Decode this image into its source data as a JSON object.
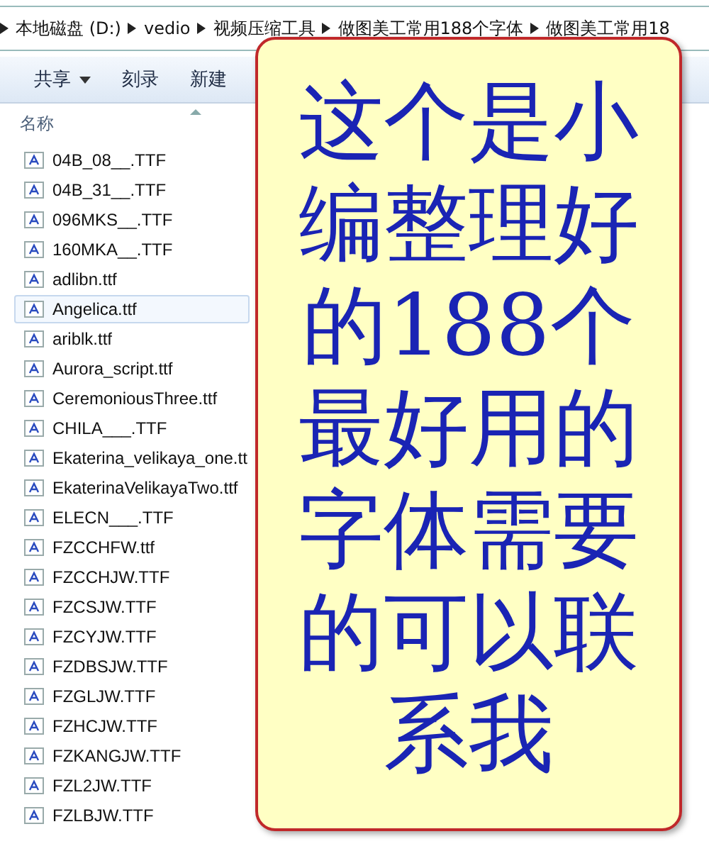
{
  "address_bar": {
    "crumbs": [
      "本地磁盘 (D:)",
      "vedio",
      "视频压缩工具",
      "做图美工常用188个字体",
      "做图美工常用18"
    ]
  },
  "toolbar": {
    "buttons": [
      {
        "label": "共享",
        "dropdown": true
      },
      {
        "label": "刻录",
        "dropdown": false
      },
      {
        "label": "新建",
        "dropdown": false
      }
    ]
  },
  "file_list": {
    "column_header": "名称",
    "files": [
      {
        "name": "04B_08__.TTF",
        "selected": false
      },
      {
        "name": "04B_31__.TTF",
        "selected": false
      },
      {
        "name": "096MKS__.TTF",
        "selected": false
      },
      {
        "name": "160MKA__.TTF",
        "selected": false
      },
      {
        "name": "adlibn.ttf",
        "selected": false
      },
      {
        "name": "Angelica.ttf",
        "selected": true
      },
      {
        "name": "ariblk.ttf",
        "selected": false
      },
      {
        "name": "Aurora_script.ttf",
        "selected": false
      },
      {
        "name": "CeremoniousThree.ttf",
        "selected": false
      },
      {
        "name": "CHILA___.TTF",
        "selected": false
      },
      {
        "name": "Ekaterina_velikaya_one.tt",
        "selected": false
      },
      {
        "name": "EkaterinaVelikayaTwo.ttf",
        "selected": false
      },
      {
        "name": "ELECN___.TTF",
        "selected": false
      },
      {
        "name": "FZCCHFW.ttf",
        "selected": false
      },
      {
        "name": "FZCCHJW.TTF",
        "selected": false
      },
      {
        "name": "FZCSJW.TTF",
        "selected": false
      },
      {
        "name": "FZCYJW.TTF",
        "selected": false
      },
      {
        "name": "FZDBSJW.TTF",
        "selected": false
      },
      {
        "name": "FZGLJW.TTF",
        "selected": false
      },
      {
        "name": "FZHCJW.TTF",
        "selected": false
      },
      {
        "name": "FZKANGJW.TTF",
        "selected": false
      },
      {
        "name": "FZL2JW.TTF",
        "selected": false
      },
      {
        "name": "FZLBJW.TTF",
        "selected": false
      }
    ]
  },
  "callout": {
    "lines": [
      "这个是小",
      "编整理好",
      "的188个",
      "最好用的",
      "字体需要",
      "的可以联",
      "系我"
    ]
  }
}
